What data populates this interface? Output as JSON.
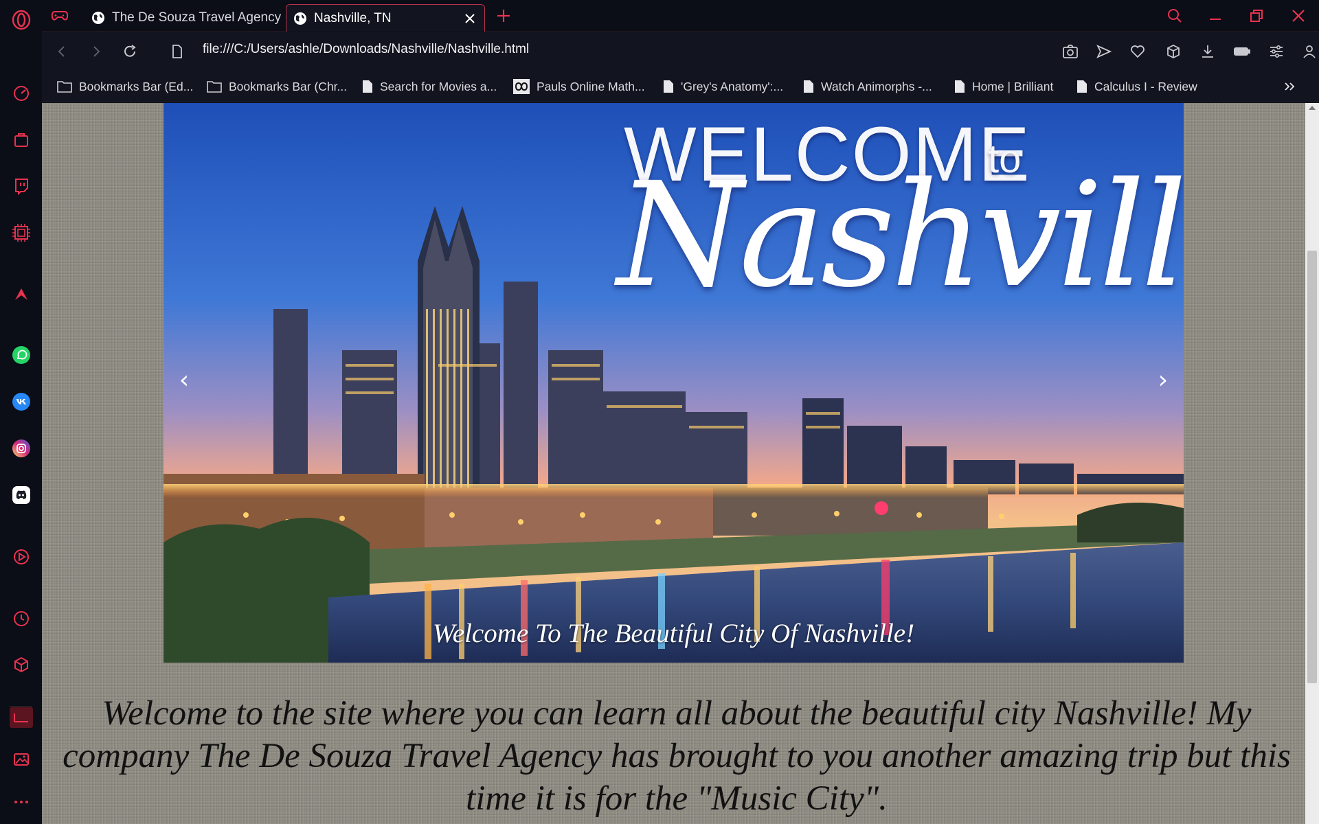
{
  "browser": {
    "tabs": [
      {
        "title": "The De Souza Travel Agency",
        "active": false
      },
      {
        "title": "Nashville, TN",
        "active": true
      }
    ],
    "url": "file:///C:/Users/ashle/Downloads/Nashville/Nashville.html",
    "bookmarks": [
      {
        "label": "Bookmarks Bar (Ed...",
        "icon": "folder-icon"
      },
      {
        "label": "Bookmarks Bar (Chr...",
        "icon": "folder-icon"
      },
      {
        "label": "Search for Movies a...",
        "icon": "page-icon"
      },
      {
        "label": "Pauls Online Math...",
        "icon": "infinity-icon"
      },
      {
        "label": "'Grey's Anatomy':...",
        "icon": "page-icon"
      },
      {
        "label": "Watch Animorphs -...",
        "icon": "page-icon"
      },
      {
        "label": "Home | Brilliant",
        "icon": "page-icon"
      },
      {
        "label": "Calculus I - Review",
        "icon": "page-icon"
      }
    ],
    "sidebar_icons": [
      "opera-logo-icon",
      "speed-dial-icon",
      "shopping-bag-icon",
      "twitch-icon",
      "memory-chip-icon",
      "aria-icon",
      "whatsapp-icon",
      "vk-icon",
      "instagram-icon",
      "discord-icon",
      "player-icon",
      "history-icon",
      "extensions-icon",
      "gx-corner-icon",
      "gallery-icon",
      "more-icon"
    ],
    "accent_color": "#e8334f"
  },
  "page": {
    "carousel": {
      "hero_welcome": "WELCOME",
      "hero_to": "to",
      "hero_city": "Nashville",
      "caption": "Welcome To The Beautiful City Of Nashville!",
      "prev_arrow": "‹",
      "next_arrow": "›"
    },
    "intro_text": "Welcome to the site where you can learn all about the beautiful city Nashville! My company The De Souza Travel Agency has brought to you another amazing trip but this time it is for the \"Music City\"."
  }
}
